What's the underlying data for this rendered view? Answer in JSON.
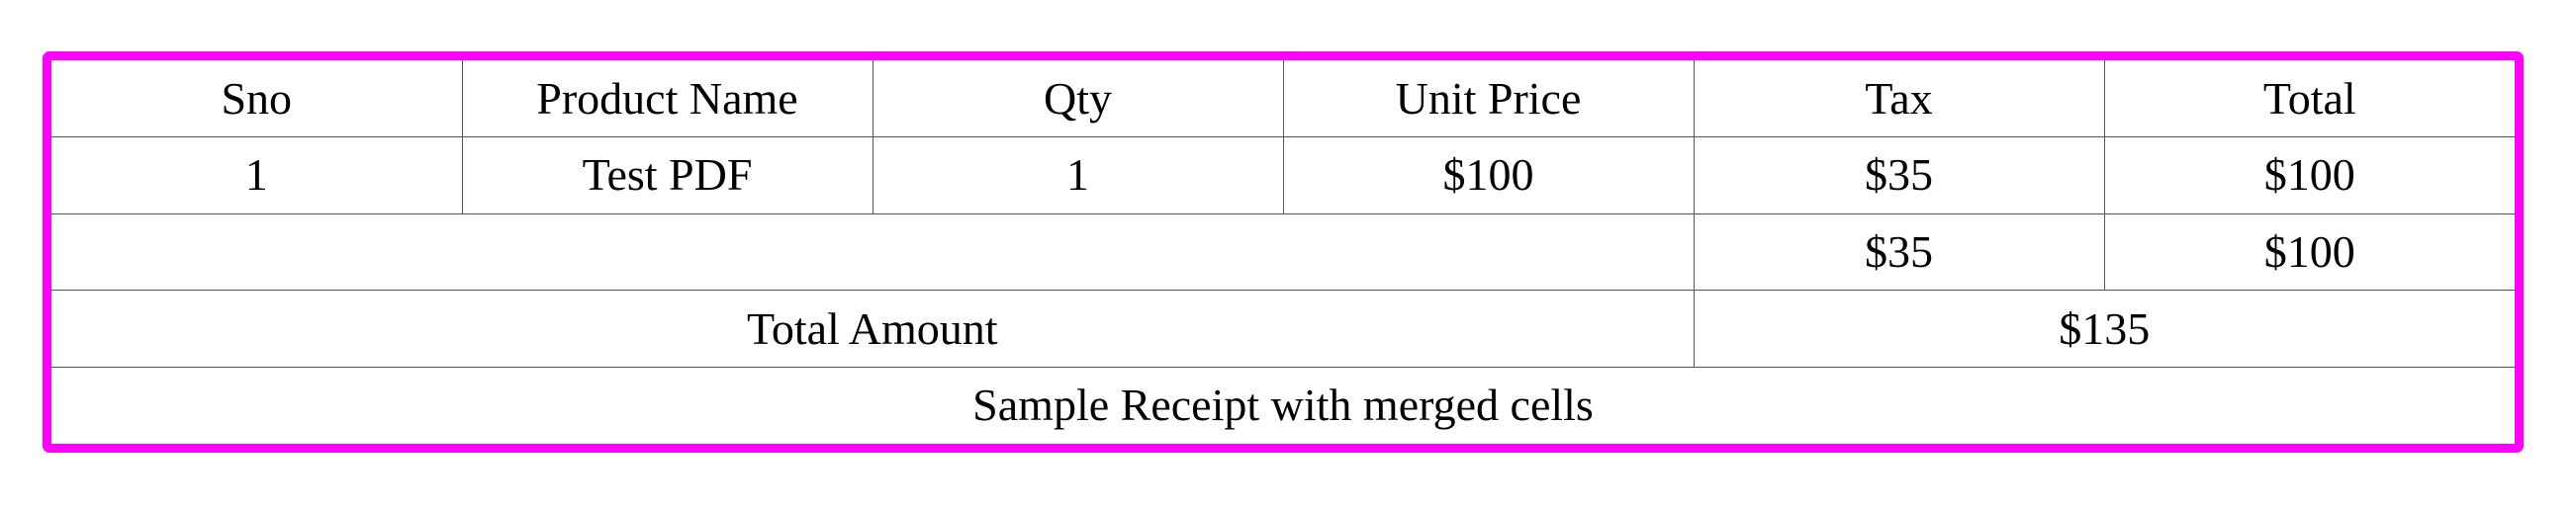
{
  "table": {
    "headers": [
      "Sno",
      "Product Name",
      "Qty",
      "Unit Price",
      "Tax",
      "Total"
    ],
    "items": [
      {
        "sno": "1",
        "product": "Test PDF",
        "qty": "1",
        "unit_price": "$100",
        "tax": "$35",
        "total": "$100"
      }
    ],
    "subtotal": {
      "tax": "$35",
      "total": "$100"
    },
    "total_amount": {
      "label": "Total Amount",
      "value": "$135"
    },
    "caption": "Sample Receipt with merged cells"
  },
  "colors": {
    "frame_border": "#ff00ff",
    "grid_lines": "#555555",
    "text": "#000000"
  }
}
